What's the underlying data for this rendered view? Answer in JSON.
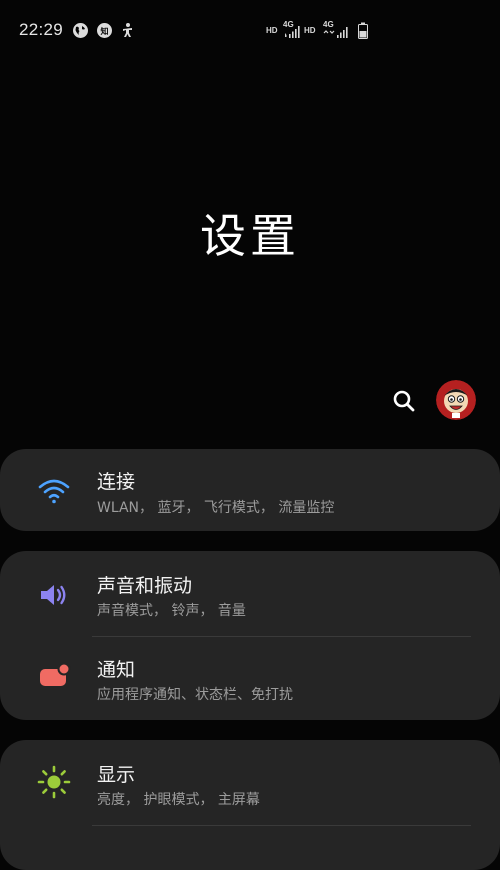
{
  "status_bar": {
    "time": "22:29",
    "icons": [
      "globe-icon",
      "zhihu-icon",
      "accessibility-icon"
    ],
    "network": [
      "HD",
      "4G",
      "HD",
      "4G"
    ],
    "battery_icon": "battery-icon"
  },
  "header": {
    "title": "设置",
    "search_icon": "search-icon",
    "avatar_icon": "avatar-icon"
  },
  "settings": [
    {
      "title": "连接",
      "subtitle": "WLAN， 蓝牙， 飞行模式， 流量监控",
      "icon": "wifi-icon",
      "color": "#4da3ff"
    },
    {
      "title": "声音和振动",
      "subtitle": "声音模式， 铃声， 音量",
      "icon": "volume-icon",
      "color": "#8c83f0"
    },
    {
      "title": "通知",
      "subtitle": "应用程序通知、状态栏、免打扰",
      "icon": "notification-icon",
      "color": "#f06b63"
    },
    {
      "title": "显示",
      "subtitle": "亮度， 护眼模式， 主屏幕",
      "icon": "brightness-icon",
      "color": "#9ccc3a"
    }
  ]
}
